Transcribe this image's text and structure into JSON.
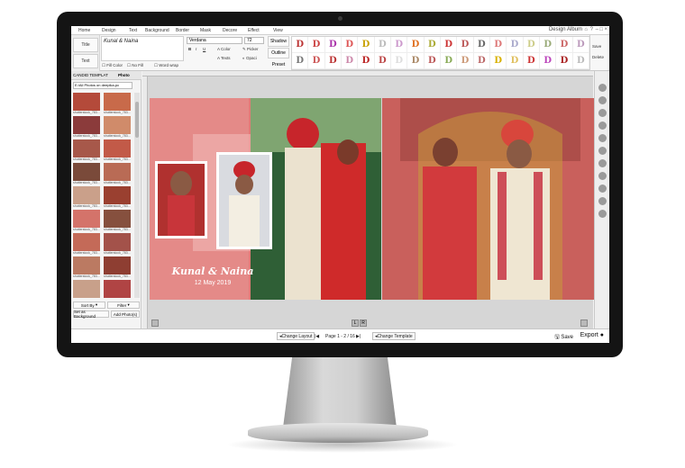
{
  "app": {
    "title": "Design Album",
    "window_controls": [
      "⌂",
      "?",
      "–",
      "□",
      "×"
    ]
  },
  "menubar": {
    "items": [
      "Home",
      "Design",
      "Text",
      "Background",
      "Border",
      "Mask",
      "Decore",
      "Effect",
      "View"
    ]
  },
  "ribbon": {
    "title_label": "Title",
    "text_label": "Text",
    "title_value": "Kunal & Naina",
    "font_value": "Verdana",
    "size_value": "72",
    "bold": "B",
    "italic": "I",
    "underline": "U",
    "color_label": "Color",
    "texts_label": "Texts",
    "picker_label": "Picker",
    "opacity_label": "Opaci",
    "shadow_label": "Shadow",
    "outline_label": "Outline",
    "preset_label": "Preset",
    "fill_color_label": "Fill Color",
    "no_fill_label": "No Fill",
    "word_wrap_label": "Word wrap",
    "save_label": "Save",
    "delete_label": "Delete",
    "style_glyph": "D",
    "style_colors_row1": [
      "#b33",
      "#c44",
      "#a3a",
      "#d55",
      "#c8a000",
      "#bbb",
      "#c9c",
      "#e07020",
      "#aa3",
      "#c33",
      "#b55",
      "#666",
      "#d77",
      "#aac",
      "#cc8",
      "#9a7",
      "#c66",
      "#b9b"
    ],
    "style_colors_row2": [
      "#777",
      "#c55",
      "#b33",
      "#c8a",
      "#b22",
      "#b44",
      "#ddd",
      "#a86",
      "#b55",
      "#8a5",
      "#c97",
      "#b66",
      "#d8b000",
      "#e0c060",
      "#c33",
      "#b4b",
      "#a22",
      "#bbb"
    ]
  },
  "left_panel": {
    "tab_template": "CANDID TEMPLAT",
    "tab_photo": "Photo",
    "path": "E:/All Photos on deepika-pc",
    "thumb_caption": "shutterstock_783...",
    "sort_label": "Sort By",
    "filter_label": "Filter",
    "set_bg_label": "Set as Background",
    "add_photos_label": "Add Photo(s)"
  },
  "canvas": {
    "names_text": "Kunal & Naina",
    "date_text": "12 May 2019",
    "left_marker": "L",
    "right_marker": "R"
  },
  "statusbar": {
    "change_layout": "Change Layout",
    "page_info": "Page 1 - 2 / 16",
    "change_template": "Change Template",
    "save": "Save",
    "export": "Export"
  },
  "colors": {
    "accent": "#e27a78",
    "right_page": "#c9605c",
    "bezel": "#141414"
  }
}
